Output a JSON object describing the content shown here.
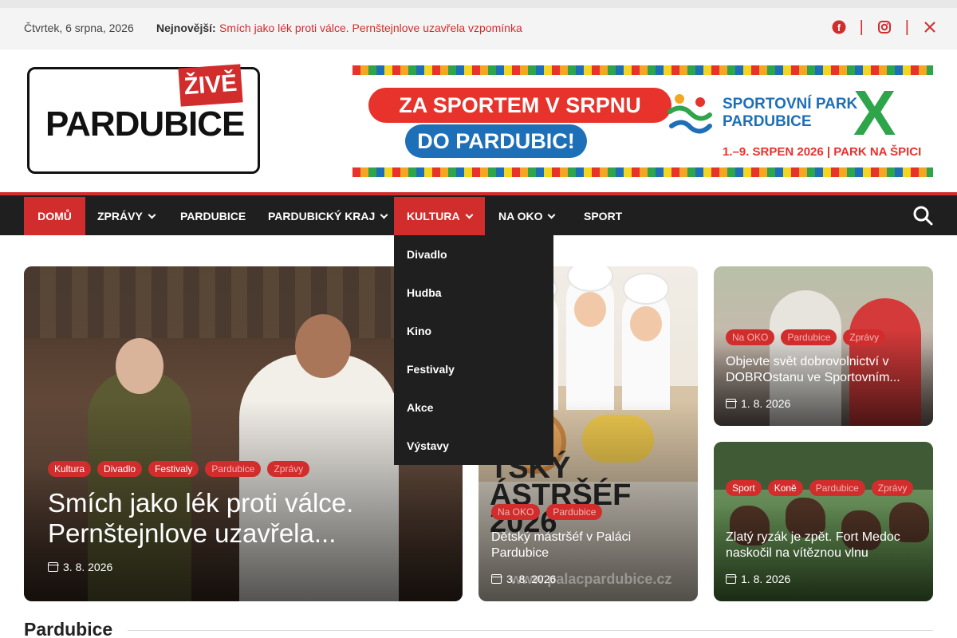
{
  "topbar": {
    "date": "Čtvrtek, 6 srpna, 2026",
    "latest_label": "Nejnovější:",
    "latest_text": "Smích jako lék proti válce. Pernštejnlove uzavřela vzpomínka",
    "social": [
      "facebook-icon",
      "instagram-icon",
      "x-icon"
    ]
  },
  "logo": {
    "main": "PARDUBICE",
    "live": "ŽIVĚ"
  },
  "banner": {
    "line1": "ZA SPORTEM V SRPNU",
    "line2": "DO PARDUBIC!",
    "brand_name": "SPORTOVNÍ PARK PARDUBICE",
    "brand_x": "X",
    "dates": "1.–9. SRPEN 2026 | PARK NA ŠPICI"
  },
  "colors": {
    "accent": "#d12d2d",
    "nav_bg": "#1f1f1f",
    "topbar_bg": "#f4f4f4"
  },
  "nav": {
    "items": [
      {
        "label": "DOMŮ",
        "active": true,
        "has_dropdown": false
      },
      {
        "label": "ZPRÁVY",
        "active": false,
        "has_dropdown": true
      },
      {
        "label": "PARDUBICE",
        "active": false,
        "has_dropdown": false
      },
      {
        "label": "PARDUBICKÝ KRAJ",
        "active": false,
        "has_dropdown": true
      },
      {
        "label": "KULTURA",
        "active": true,
        "has_dropdown": true
      },
      {
        "label": "NA OKO",
        "active": false,
        "has_dropdown": true
      },
      {
        "label": "SPORT",
        "active": false,
        "has_dropdown": false
      }
    ],
    "search_icon": "search-icon"
  },
  "dropdown": {
    "items": [
      "Divadlo",
      "Hudba",
      "Kino",
      "Festivaly",
      "Akce",
      "Výstavy"
    ]
  },
  "articles": {
    "main": {
      "tags": [
        "Kultura",
        "Divadlo",
        "Festivaly",
        "Pardubice",
        "Zprávy"
      ],
      "title": "Smích jako lék proti válce. Pernštejnlove uzavřela...",
      "date": "3. 8. 2026"
    },
    "mid": {
      "image_text": "TSKÝ\nÁSTRŠÉF\n2026",
      "image_url_text": "www.palacpardubice.cz",
      "tags": [
        "Na OKO",
        "Pardubice"
      ],
      "title": "Dětský mástršéf v Paláci Pardubice",
      "date": "3. 8. 2026"
    },
    "top_right": {
      "tags": [
        "Na OKO",
        "Pardubice",
        "Zprávy"
      ],
      "title": "Objevte svět dobrovolnictví v DOBROstanu ve Sportovním...",
      "date": "1. 8. 2026"
    },
    "bottom_right": {
      "tags": [
        "Sport",
        "Koně",
        "Pardubice",
        "Zprávy"
      ],
      "title": "Zlatý ryzák je zpět. Fort Medoc naskočil na vítěznou vlnu",
      "date": "1. 8. 2026"
    }
  },
  "section": {
    "title": "Pardubice"
  }
}
